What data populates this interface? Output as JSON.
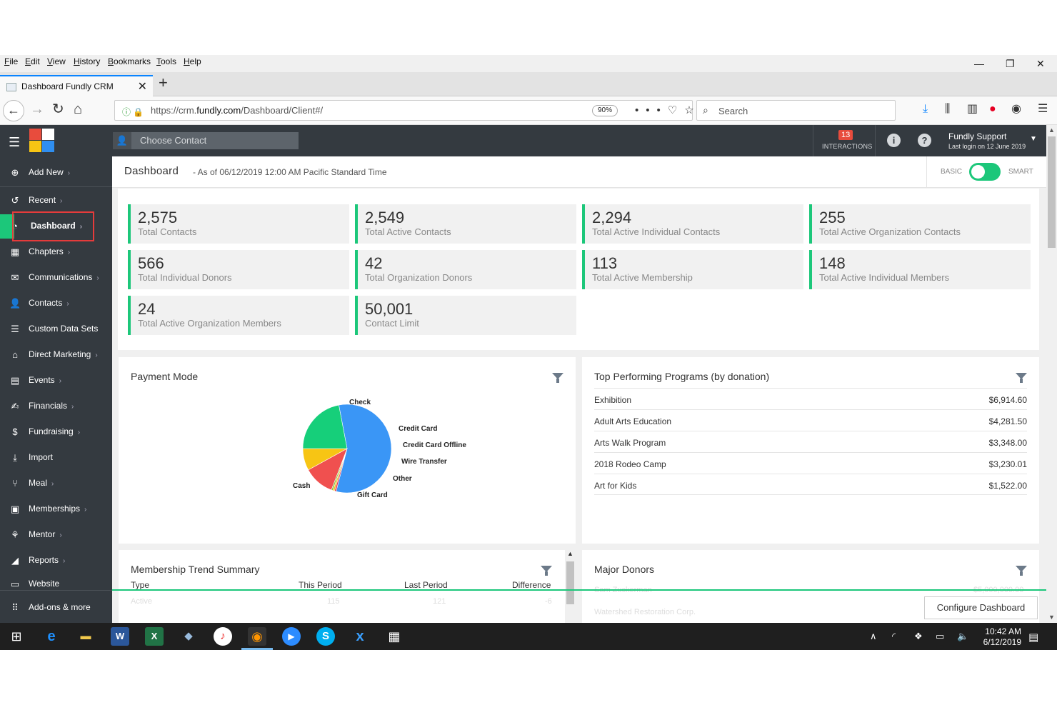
{
  "menubar": [
    "File",
    "Edit",
    "View",
    "History",
    "Bookmarks",
    "Tools",
    "Help"
  ],
  "browser": {
    "tab_title": "Dashboard Fundly CRM",
    "url_prefix": "https://crm.",
    "url_domain": "fundly.com",
    "url_suffix": "/Dashboard/Client#/",
    "zoom": "90%",
    "search_placeholder": "Search"
  },
  "app": {
    "contact_placeholder": "Choose Contact",
    "interactions_count": "13",
    "interactions_label": "INTERACTIONS",
    "user_name": "Fundly Support",
    "last_login": "Last login on 12 June 2019"
  },
  "sidebar": [
    {
      "label": "Add New",
      "icon": "plus-circle-icon",
      "chev": true
    },
    {
      "label": "Recent",
      "icon": "history-icon",
      "chev": true
    },
    {
      "label": "Dashboard",
      "icon": "dashboard-icon",
      "chev": true,
      "active": true
    },
    {
      "label": "Chapters",
      "icon": "grid-icon",
      "chev": true
    },
    {
      "label": "Communications",
      "icon": "envelope-icon",
      "chev": true
    },
    {
      "label": "Contacts",
      "icon": "user-icon",
      "chev": true
    },
    {
      "label": "Custom Data Sets",
      "icon": "database-icon",
      "chev": false
    },
    {
      "label": "Direct Marketing",
      "icon": "home-icon",
      "chev": true
    },
    {
      "label": "Events",
      "icon": "calendar-icon",
      "chev": true
    },
    {
      "label": "Financials",
      "icon": "handshake-icon",
      "chev": true
    },
    {
      "label": "Fundraising",
      "icon": "money-bag-icon",
      "chev": true
    },
    {
      "label": "Import",
      "icon": "import-icon",
      "chev": false
    },
    {
      "label": "Meal",
      "icon": "utensils-icon",
      "chev": true
    },
    {
      "label": "Memberships",
      "icon": "id-card-icon",
      "chev": true
    },
    {
      "label": "Mentor",
      "icon": "mentor-icon",
      "chev": true
    },
    {
      "label": "Reports",
      "icon": "chart-icon",
      "chev": true
    },
    {
      "label": "Website",
      "icon": "monitor-icon",
      "chev": false
    },
    {
      "label": "Add-ons & more",
      "icon": "apps-icon",
      "chev": false
    }
  ],
  "dashboard": {
    "title": "Dashboard",
    "subtitle": "- As of 06/12/2019 12:00 AM Pacific Standard Time",
    "toggle_left": "BASIC",
    "toggle_right": "SMART",
    "stats": [
      {
        "value": "2,575",
        "label": "Total Contacts"
      },
      {
        "value": "2,549",
        "label": "Total Active Contacts"
      },
      {
        "value": "2,294",
        "label": "Total Active Individual Contacts"
      },
      {
        "value": "255",
        "label": "Total Active Organization Contacts"
      },
      {
        "value": "566",
        "label": "Total Individual Donors"
      },
      {
        "value": "42",
        "label": "Total Organization Donors"
      },
      {
        "value": "113",
        "label": "Total Active Membership"
      },
      {
        "value": "148",
        "label": "Total Active Individual Members"
      },
      {
        "value": "24",
        "label": "Total Active Organization Members"
      },
      {
        "value": "50,001",
        "label": "Contact Limit"
      }
    ]
  },
  "payment_mode": {
    "title": "Payment Mode"
  },
  "chart_data": {
    "type": "pie",
    "title": "Payment Mode",
    "slices": [
      {
        "label": "Check",
        "value": 57,
        "color": "#3a96f6"
      },
      {
        "label": "Credit Card",
        "value": 0.6,
        "color": "#e8344e"
      },
      {
        "label": "Credit Card Offline",
        "value": 0.6,
        "color": "#f0c419"
      },
      {
        "label": "Wire Transfer",
        "value": 0.6,
        "color": "#8bc34a"
      },
      {
        "label": "Other",
        "value": 11.2,
        "color": "#f0504f"
      },
      {
        "label": "Gift Card",
        "value": 8,
        "color": "#f7c514"
      },
      {
        "label": "Cash",
        "value": 22,
        "color": "#16cf7a"
      }
    ]
  },
  "programs": {
    "title": "Top Performing Programs (by donation)",
    "rows": [
      {
        "name": "Exhibition",
        "amount": "$6,914.60"
      },
      {
        "name": "Adult Arts Education",
        "amount": "$4,281.50"
      },
      {
        "name": "Arts Walk Program",
        "amount": "$3,348.00"
      },
      {
        "name": "2018 Rodeo Camp",
        "amount": "$3,230.01"
      },
      {
        "name": "Art for Kids",
        "amount": "$1,522.00"
      }
    ]
  },
  "membership_trend": {
    "title": "Membership Trend Summary",
    "headers": [
      "Type",
      "This Period",
      "Last Period",
      "Difference"
    ],
    "row": [
      "Active",
      "115",
      "121",
      "-6"
    ]
  },
  "major_donors": {
    "title": "Major Donors",
    "rows": [
      "Sam Zuckerman",
      "Watershed Restoration Corp."
    ],
    "amount_first": "$5,000,000.00"
  },
  "configure_label": "Configure Dashboard",
  "taskbar": {
    "time": "10:42 AM",
    "date": "6/12/2019"
  }
}
